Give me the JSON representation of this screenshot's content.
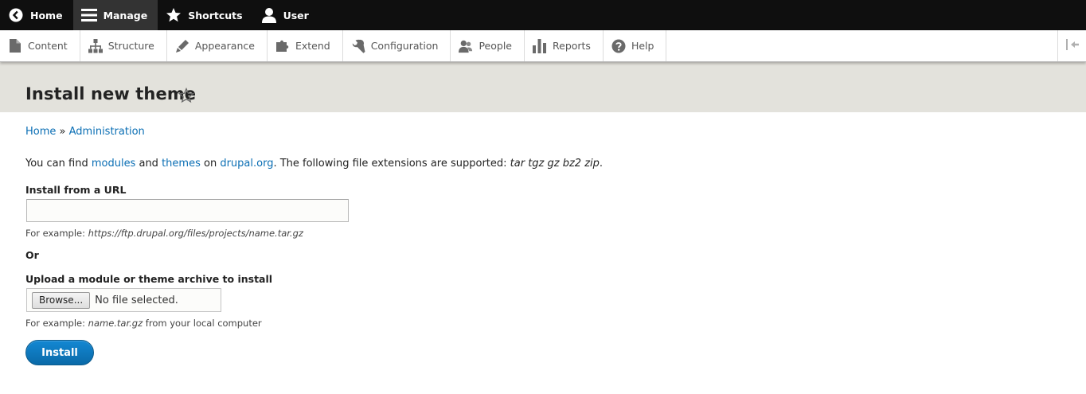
{
  "toolbar": {
    "items": [
      {
        "label": "Home",
        "icon": "back-circle-icon"
      },
      {
        "label": "Manage",
        "icon": "hamburger-icon"
      },
      {
        "label": "Shortcuts",
        "icon": "star-icon"
      },
      {
        "label": "User",
        "icon": "user-icon"
      }
    ]
  },
  "tray": {
    "items": [
      {
        "label": "Content",
        "icon": "file-icon"
      },
      {
        "label": "Structure",
        "icon": "hierarchy-icon"
      },
      {
        "label": "Appearance",
        "icon": "paintbrush-icon"
      },
      {
        "label": "Extend",
        "icon": "puzzle-icon"
      },
      {
        "label": "Configuration",
        "icon": "wrench-icon"
      },
      {
        "label": "People",
        "icon": "people-icon"
      },
      {
        "label": "Reports",
        "icon": "bar-chart-icon"
      },
      {
        "label": "Help",
        "icon": "help-circle-icon"
      }
    ]
  },
  "page": {
    "title": "Install new theme"
  },
  "breadcrumb": {
    "home": "Home",
    "separator": "»",
    "admin": "Administration"
  },
  "intro": {
    "p1": "You can find ",
    "modules": "modules",
    "p2": " and ",
    "themes": "themes",
    "p3": " on ",
    "drupal": "drupal.org",
    "p4": ". The following file extensions are supported: ",
    "extensions": "tar tgz gz bz2 zip",
    "p5": "."
  },
  "form": {
    "url_label": "Install from a URL",
    "url_value": "",
    "url_desc_prefix": "For example: ",
    "url_desc_example": "https://ftp.drupal.org/files/projects/name.tar.gz",
    "or_label": "Or",
    "upload_label": "Upload a module or theme archive to install",
    "browse_label": "Browse...",
    "no_file": "No file selected.",
    "upload_desc_prefix": "For example: ",
    "upload_desc_example": "name.tar.gz",
    "upload_desc_suffix": " from your local computer",
    "install_label": "Install"
  },
  "colors": {
    "toolbar_bg": "#0f0f0f",
    "header_band": "#e3e2dc",
    "link": "#0a6eb4",
    "primary_button": "#0a6aa8"
  }
}
